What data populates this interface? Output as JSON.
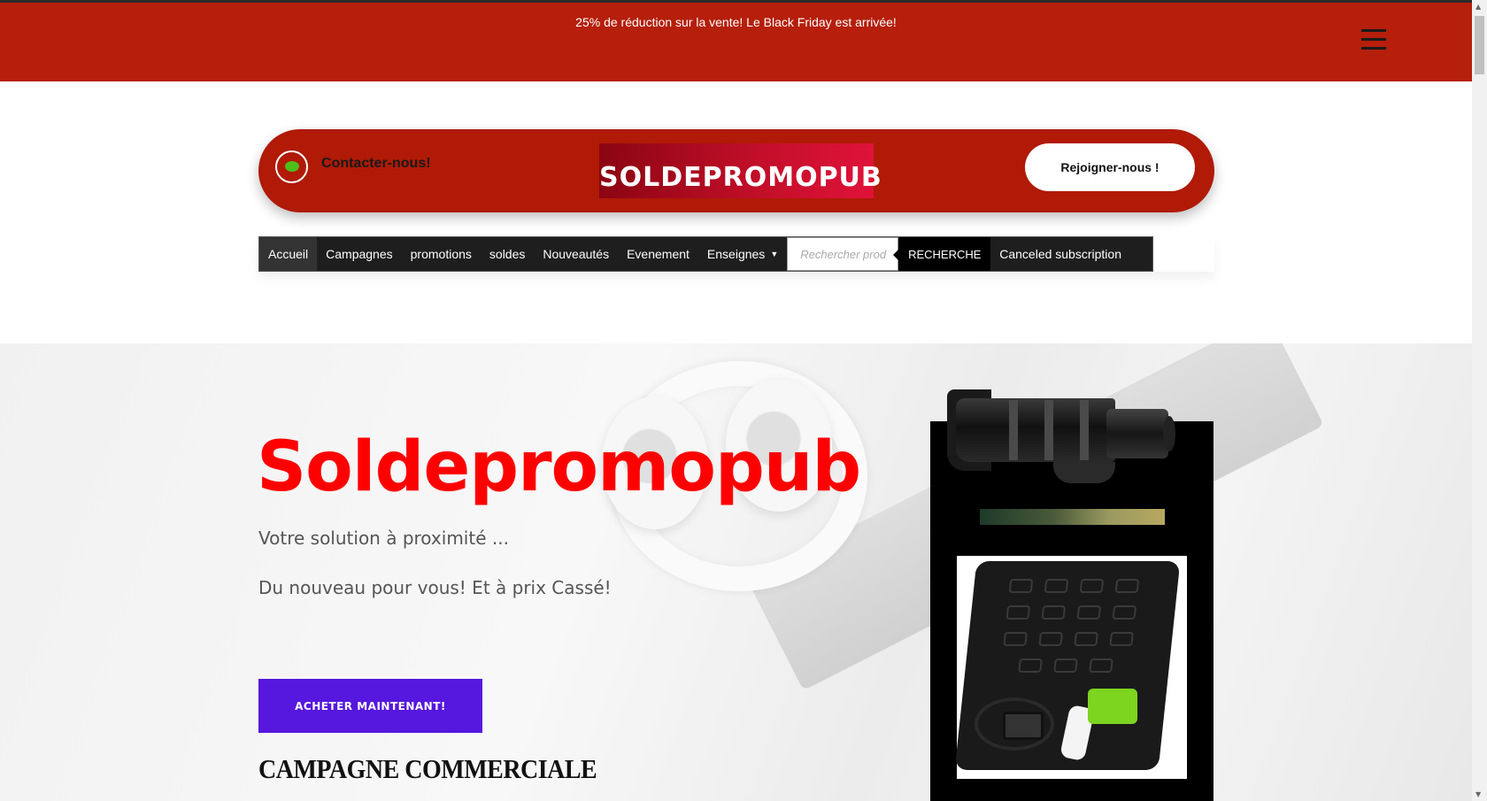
{
  "promo_bar": {
    "text": "25%  de réduction sur la vente! Le Black Friday est arrivée!"
  },
  "header": {
    "contact_label": "Contacter-nous!",
    "logo_text": "SOLDEPROMOPUB",
    "join_label": "Rejoigner-nous !"
  },
  "nav": {
    "items": [
      {
        "label": "Accueil",
        "active": true
      },
      {
        "label": "Campagnes"
      },
      {
        "label": "promotions"
      },
      {
        "label": "soldes"
      },
      {
        "label": "Nouveautés"
      },
      {
        "label": "Evenement"
      },
      {
        "label": "Enseignes",
        "has_dropdown": true
      }
    ],
    "search_placeholder": "Rechercher produits...",
    "search_visible_text": "Rechercher prod",
    "search_button": "RECHERCHE",
    "extra_item": "Canceled subscription"
  },
  "hero": {
    "title": "Soldepromopub",
    "subtitle1": "Votre solution à proximité ...",
    "subtitle2": "Du nouveau pour vous! Et à prix Cassé!",
    "cta_label": "ACHETER MAINTENANT!",
    "section_title": "CAMPAGNE COMMERCIALE"
  },
  "colors": {
    "promo_red": "#b51f0b",
    "header_red": "#b01a06",
    "title_red": "#ff0000",
    "cta_purple": "#5617de",
    "nav_dark": "#1e1e1e"
  },
  "icons": [
    "menu-icon",
    "chat-icon",
    "dropdown-caret-icon"
  ]
}
